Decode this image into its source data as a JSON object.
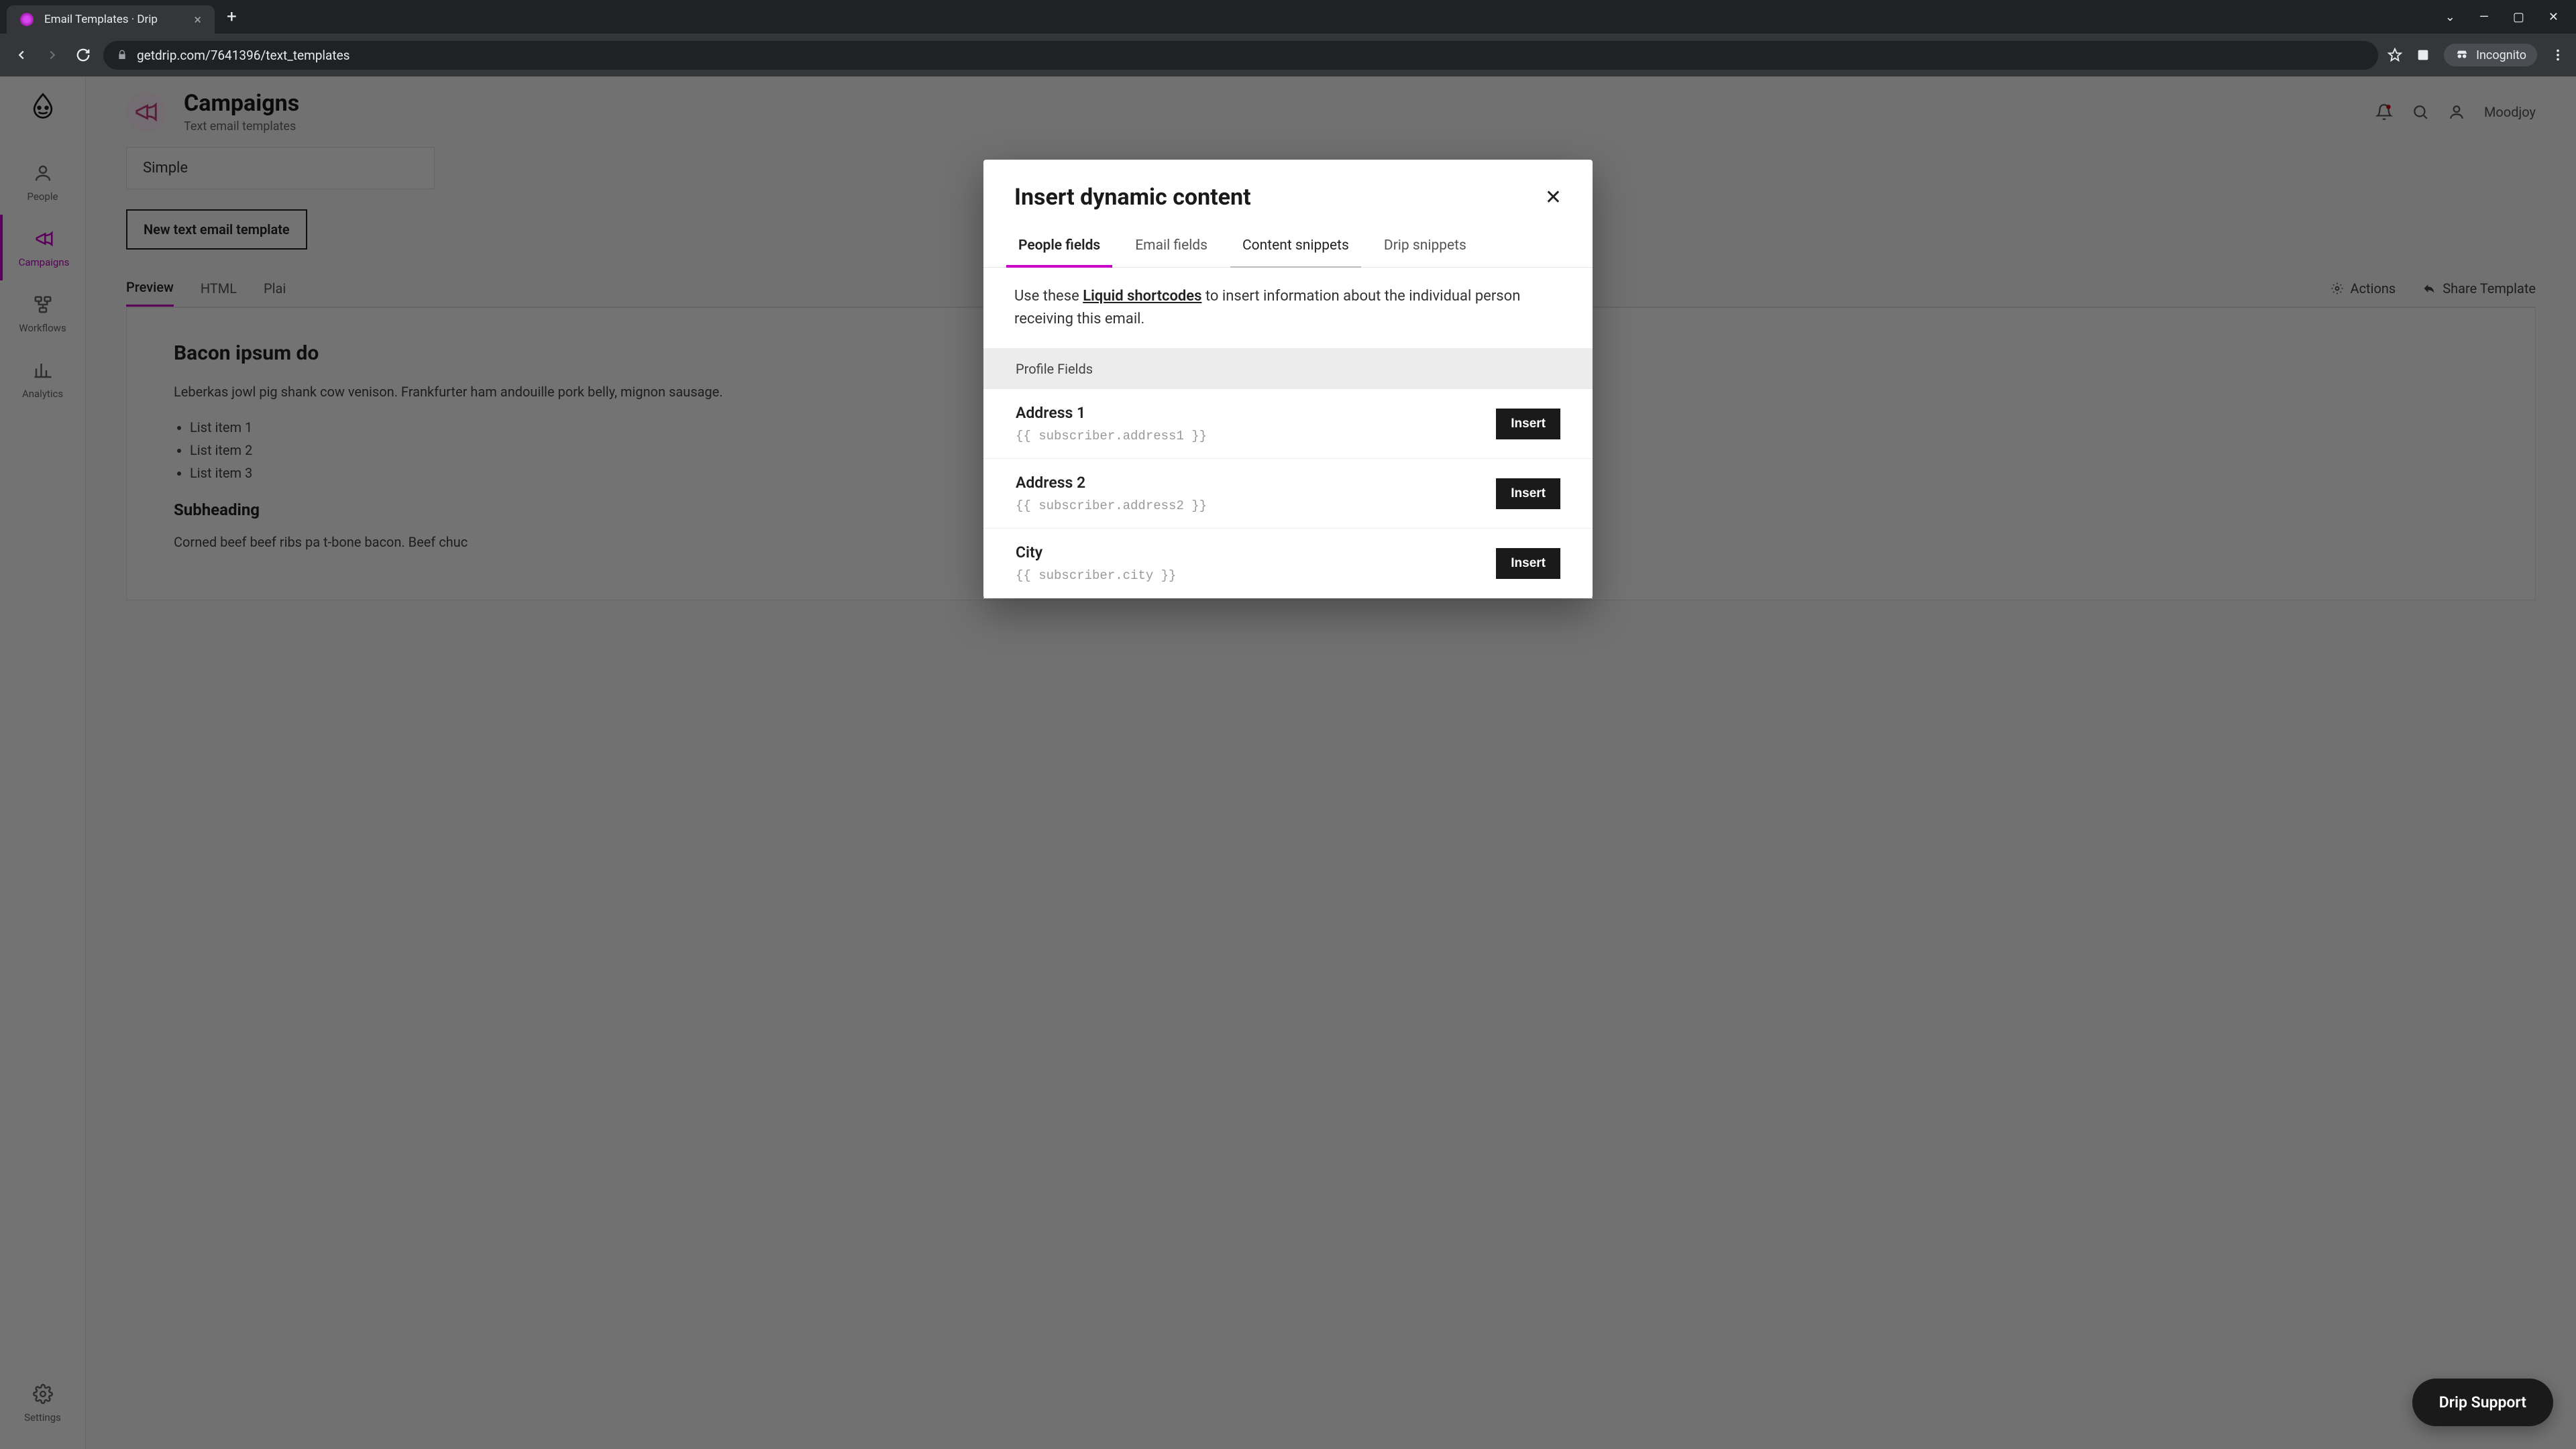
{
  "browser": {
    "tab_title": "Email Templates · Drip",
    "url": "getdrip.com/7641396/text_templates",
    "incognito_label": "Incognito"
  },
  "sidebar": {
    "items": [
      {
        "label": "People"
      },
      {
        "label": "Campaigns"
      },
      {
        "label": "Workflows"
      },
      {
        "label": "Analytics"
      }
    ],
    "settings_label": "Settings"
  },
  "header": {
    "title": "Campaigns",
    "subtitle": "Text email templates",
    "user": "Moodjoy"
  },
  "content": {
    "template_name": "Simple",
    "new_button": "New text email template",
    "tabs": [
      "Preview",
      "HTML",
      "Plai"
    ],
    "actions_label": "Actions",
    "share_label": "Share Template",
    "body_h1": "Bacon ipsum do",
    "body_p1": "Leberkas jowl pig shank cow venison. Frankfurter ham andouille pork belly, mignon sausage.",
    "list": [
      "List item 1",
      "List item 2",
      "List item 3"
    ],
    "body_h2": "Subheading",
    "body_p2": "Corned beef beef ribs pa t-bone bacon. Beef chuc"
  },
  "modal": {
    "title": "Insert dynamic content",
    "tabs": [
      "People fields",
      "Email fields",
      "Content snippets",
      "Drip snippets"
    ],
    "desc_prefix": "Use these ",
    "desc_link": "Liquid shortcodes",
    "desc_suffix": " to insert information about the individual person receiving this email.",
    "section": "Profile Fields",
    "insert_label": "Insert",
    "fields": [
      {
        "name": "Address 1",
        "code": "{{ subscriber.address1 }}"
      },
      {
        "name": "Address 2",
        "code": "{{ subscriber.address2 }}"
      },
      {
        "name": "City",
        "code": "{{ subscriber.city }}"
      }
    ]
  },
  "support_btn": "Drip Support"
}
